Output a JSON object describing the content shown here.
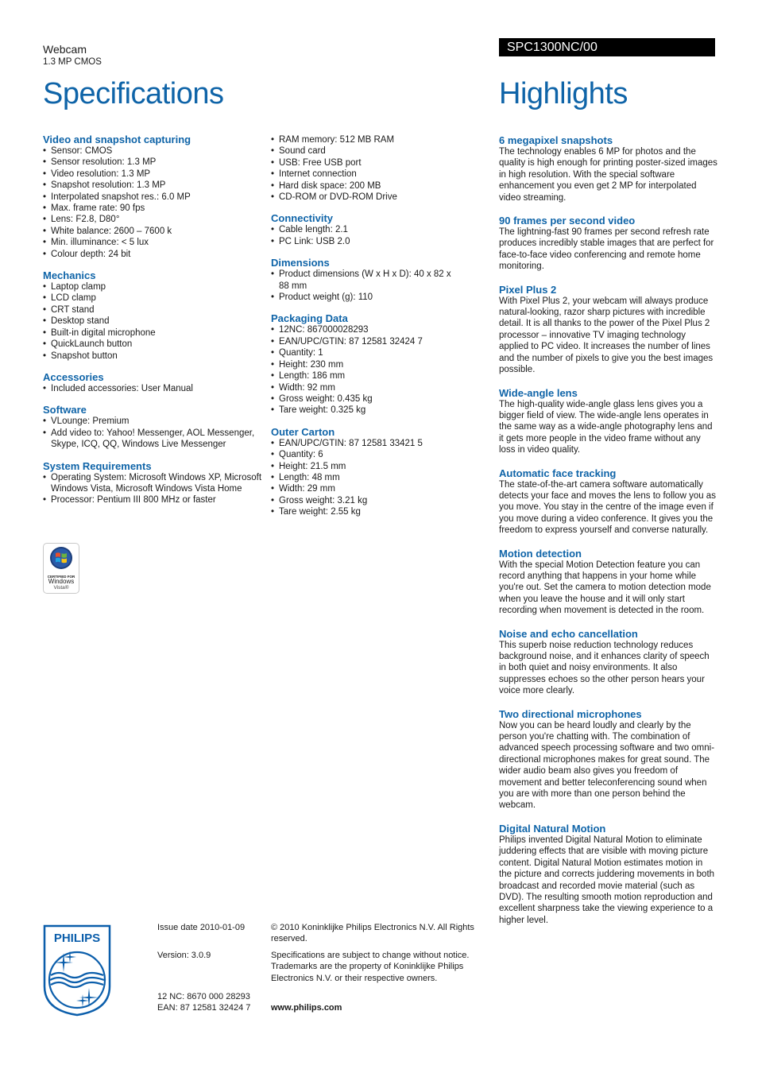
{
  "header": {
    "product_name": "Webcam",
    "product_subtitle": "1.3 MP CMOS",
    "model_number": "SPC1300NC/00",
    "specifications_title": "Specifications",
    "highlights_title": "Highlights"
  },
  "specifications": {
    "column_a": [
      {
        "title": "Video and snapshot capturing",
        "items": [
          "Sensor: CMOS",
          "Sensor resolution: 1.3 MP",
          "Video resolution: 1.3 MP",
          "Snapshot resolution: 1.3 MP",
          "Interpolated snapshot res.: 6.0 MP",
          "Max. frame rate: 90 fps",
          "Lens: F2.8, D80°",
          "White balance: 2600 – 7600 k",
          "Min. illuminance: < 5 lux",
          "Colour depth: 24 bit"
        ]
      },
      {
        "title": "Mechanics",
        "items": [
          "Laptop clamp",
          "LCD clamp",
          "CRT stand",
          "Desktop stand",
          "Built-in digital microphone",
          "QuickLaunch button",
          "Snapshot button"
        ]
      },
      {
        "title": "Accessories",
        "items": [
          "Included accessories: User Manual"
        ]
      },
      {
        "title": "Software",
        "items": [
          "VLounge: Premium",
          "Add video to: Yahoo! Messenger, AOL Messenger, Skype, ICQ, QQ, Windows Live Messenger"
        ]
      },
      {
        "title": "System Requirements",
        "items": [
          "Operating System: Microsoft Windows XP, Microsoft Windows Vista, Microsoft Windows Vista Home",
          "Processor: Pentium III 800 MHz or faster"
        ]
      }
    ],
    "column_b_continued": [
      "RAM memory: 512 MB RAM",
      "Sound card",
      "USB: Free USB port",
      "Internet connection",
      "Hard disk space: 200 MB",
      "CD-ROM or DVD-ROM Drive"
    ],
    "column_b": [
      {
        "title": "Connectivity",
        "items": [
          "Cable length: 2.1",
          "PC Link: USB 2.0"
        ]
      },
      {
        "title": "Dimensions",
        "items": [
          "Product dimensions (W x H x D): 40 x 82 x 88 mm",
          "Product weight (g): 110"
        ]
      },
      {
        "title": "Packaging Data",
        "items": [
          "12NC: 867000028293",
          "EAN/UPC/GTIN: 87 12581 32424 7",
          "Quantity: 1",
          "Height: 230 mm",
          "Length: 186 mm",
          "Width: 92 mm",
          "Gross weight: 0.435 kg",
          "Tare weight: 0.325 kg"
        ]
      },
      {
        "title": "Outer Carton",
        "items": [
          "EAN/UPC/GTIN: 87 12581 33421 5",
          "Quantity: 6",
          "Height: 21.5 mm",
          "Length: 48 mm",
          "Width: 29 mm",
          "Gross weight: 3.21 kg",
          "Tare weight: 2.55 kg"
        ]
      }
    ]
  },
  "vista_badge": {
    "icon": "windows-flag-icon",
    "line1": "CERTIFIED FOR",
    "line2": "Windows",
    "line3": "Vista®"
  },
  "highlights": [
    {
      "title": "6 megapixel snapshots",
      "text": "The technology enables 6 MP for photos and the quality is high enough for printing poster-sized images in high resolution. With the special software enhancement you even get 2 MP for interpolated video streaming."
    },
    {
      "title": "90 frames per second video",
      "text": "The lightning-fast 90 frames per second refresh rate produces incredibly stable images that are perfect for face-to-face video conferencing and remote home monitoring."
    },
    {
      "title": "Pixel Plus 2",
      "text": "With Pixel Plus 2, your webcam will always produce natural-looking, razor sharp pictures with incredible detail. It is all thanks to the power of the Pixel Plus 2 processor – innovative TV imaging technology applied to PC video. It increases the number of lines and the number of pixels to give you the best images possible."
    },
    {
      "title": "Wide-angle lens",
      "text": "The high-quality wide-angle glass lens gives you a bigger field of view. The wide-angle lens operates in the same way as a wide-angle photography lens and it gets more people in the video frame without any loss in video quality."
    },
    {
      "title": "Automatic face tracking",
      "text": "The state-of-the-art camera software automatically detects your face and moves the lens to follow you as you move. You stay in the centre of the image even if you move during a video conference. It gives you the freedom to express yourself and converse naturally."
    },
    {
      "title": "Motion detection",
      "text": "With the special Motion Detection feature you can record anything that happens in your home while you're out. Set the camera to motion detection mode when you leave the house and it will only start recording when movement is detected in the room."
    },
    {
      "title": "Noise and echo cancellation",
      "text": "This superb noise reduction technology reduces background noise, and it enhances clarity of speech in both quiet and noisy environments. It also suppresses echoes so the other person hears your voice more clearly."
    },
    {
      "title": "Two directional microphones",
      "text": "Now you can be heard loudly and clearly by the person you're chatting with. The combination of advanced speech processing software and two omni-directional microphones makes for great sound. The wider audio beam also gives you freedom of movement and better teleconferencing sound when you are with more than one person behind the webcam."
    },
    {
      "title": "Digital Natural Motion",
      "text": "Philips invented Digital Natural Motion to eliminate juddering effects that are visible with moving picture content. Digital Natural Motion estimates motion in the picture and corrects juddering movements in both broadcast and recorded movie material (such as DVD). The resulting smooth motion reproduction and excellent sharpness take the viewing experience to a higher level."
    }
  ],
  "footer": {
    "logo_text": "PHILIPS",
    "issue_date": "Issue date 2010-01-09",
    "version": "Version: 3.0.9",
    "nc": "12 NC: 8670 000 28293",
    "ean": "EAN: 87 12581 32424 7",
    "copyright": "© 2010 Koninklijke Philips Electronics N.V. All Rights reserved.",
    "disclaimer": "Specifications are subject to change without notice. Trademarks are the property of Koninklijke Philips Electronics N.V. or their respective owners.",
    "website": "www.philips.com"
  },
  "colors": {
    "brand_blue": "#0f64a8",
    "model_bar": "#000000"
  }
}
